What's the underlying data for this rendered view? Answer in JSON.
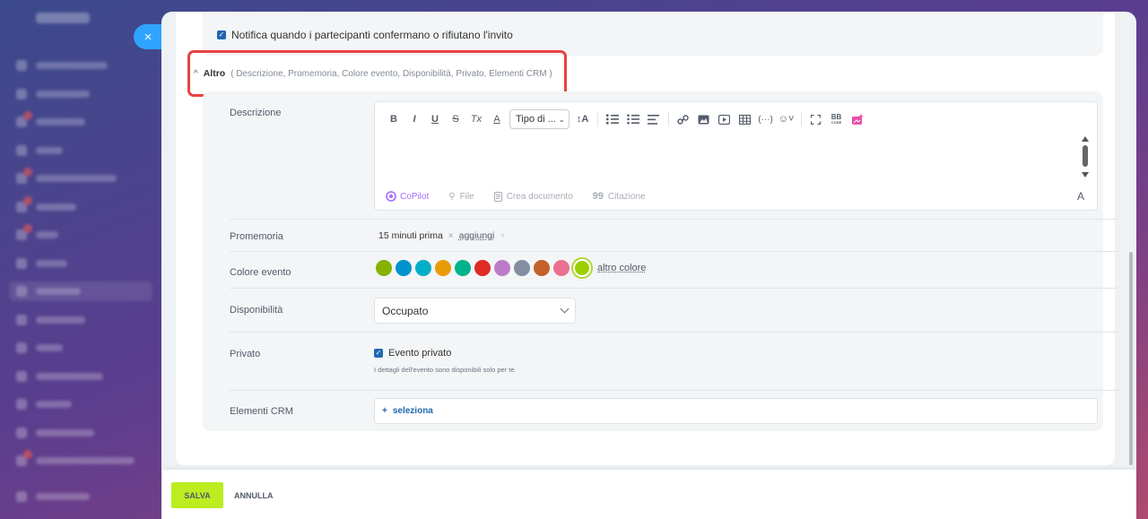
{
  "slider": {
    "close_icon": "×"
  },
  "notify": {
    "label": "Notifica quando i partecipanti confermano o rifiutano l'invito",
    "checked": true
  },
  "altro": {
    "toggle_icon": "chevron-up-icon",
    "title": "Altro",
    "list": "( Descrizione,  Promemoria,  Colore evento,  Disponibilità,  Privato,  Elementi CRM )"
  },
  "description": {
    "label": "Descrizione",
    "toolbar": {
      "bold": "B",
      "italic": "I",
      "underline": "U",
      "strike": "S",
      "clear_format": "Tx",
      "font_color": "A",
      "style_select": "Tipo di ...",
      "font_size": "↕A"
    },
    "copilot": "CoPilot",
    "file": "File",
    "create_doc": "Crea documento",
    "quote": "Citazione",
    "font_toggle": "A"
  },
  "reminder": {
    "label": "Promemoria",
    "value": "15 minuti prima",
    "add": "aggiungi"
  },
  "event_color": {
    "label": "Colore evento",
    "swatches": [
      "#86b100",
      "#0092cc",
      "#00afc7",
      "#e89b06",
      "#00b38c",
      "#de2b24",
      "#bd7ac9",
      "#838fa0",
      "#c3612c",
      "#e97090",
      "#9dcf00"
    ],
    "selected_index": 10,
    "more": "altro colore"
  },
  "availability": {
    "label": "Disponibilità",
    "value": "Occupato"
  },
  "private": {
    "label": "Privato",
    "checkbox_label": "Evento privato",
    "hint": "I dettagli dell'evento sono disponibili solo per te.",
    "checked": true
  },
  "crm": {
    "label": "Elementi CRM",
    "plus": "+",
    "select": "seleziona"
  },
  "footer": {
    "save": "SALVA",
    "cancel": "ANNULLA"
  }
}
